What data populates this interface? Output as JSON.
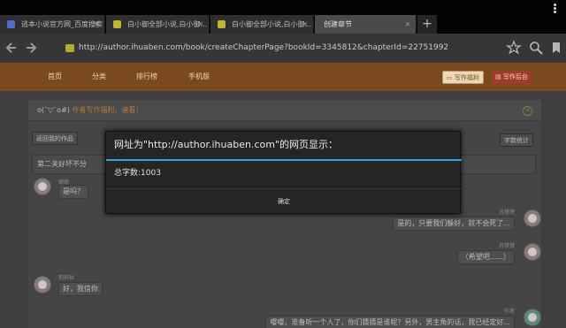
{
  "browser": {
    "tabs": [
      {
        "title": "逃本小说官方网_百度搜索",
        "fav_color": "#4b6fd0"
      },
      {
        "title": "白小御全部小说,白小御...",
        "fav_color": "#c6b52d"
      },
      {
        "title": "白小御全部小说,白小御...",
        "fav_color": "#c6b52d"
      },
      {
        "title": "创建章节",
        "fav_color": "#444444"
      }
    ],
    "new_tab": "+",
    "address": {
      "url": "http://author.ihuaben.com/book/createChapterPage?bookId=3345812&chapterId=22751992"
    },
    "icons": {
      "back": "arrow-left-icon",
      "forward": "arrow-right-icon",
      "star": "star-icon",
      "search": "search-icon",
      "bookmark": "bookmark-icon"
    }
  },
  "site": {
    "nav": [
      "首页",
      "分类",
      "排行榜",
      "手机版"
    ],
    "welfare_button": "写作福利",
    "backend_button": "写作后台",
    "notice_prefix": "o(¯▽¯o#)",
    "notice_highlight": "作者写作福利，速看！",
    "back_button": "返回我的作品",
    "wordcount_button": "字数统计",
    "chapter_title": "第二关好坏不分",
    "messages": [
      {
        "side": "left",
        "name": "娜娜",
        "text": "是吗？"
      },
      {
        "side": "right",
        "name": "苏黛黛",
        "text": "是的，只要我们躲好，就不会死了..."
      },
      {
        "side": "right",
        "name": "苏黛黛",
        "text": "（希望吧......）"
      },
      {
        "side": "left",
        "name": "莉莉丝",
        "text": "好，我信你"
      },
      {
        "side": "right",
        "name": "作者",
        "text": "嘤嘤，准备听一个人了，你们猜猜是谁呢？另外，男主角的话，我已经定好..."
      }
    ]
  },
  "dialog": {
    "title": "网址为\"http://author.ihuaben.com\"的网页显示：",
    "message": "总字数:1003",
    "ok_label": "确定"
  },
  "colors": {
    "accent": "#2aa9de",
    "nav_bar": "#7a4a1e"
  }
}
